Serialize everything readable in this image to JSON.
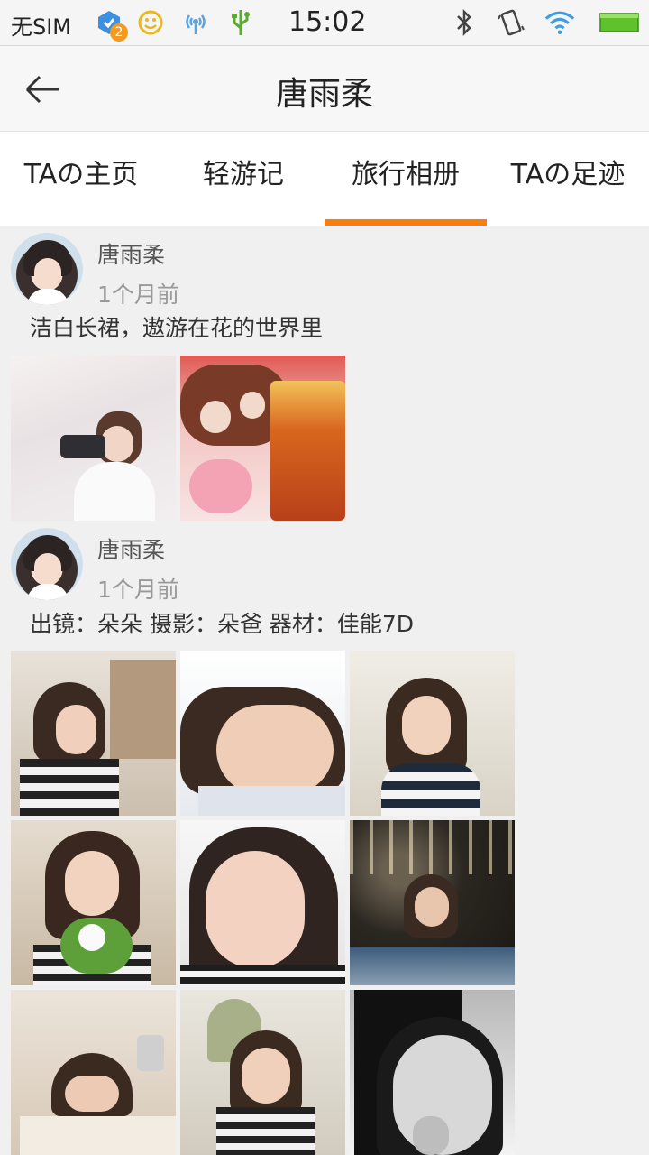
{
  "status_bar": {
    "carrier": "无SIM",
    "notification_count": "2",
    "time": "15:02"
  },
  "header": {
    "title": "唐雨柔",
    "back_icon": "arrow-left-icon"
  },
  "tabs": [
    {
      "label": "TAの主页",
      "active": false
    },
    {
      "label": "轻游记",
      "active": false
    },
    {
      "label": "旅行相册",
      "active": true
    },
    {
      "label": "TAの足迹",
      "active": false
    }
  ],
  "colors": {
    "accent": "#fb7d0c",
    "background": "#f0f0f0"
  },
  "posts": [
    {
      "author": "唐雨柔",
      "time": "1个月前",
      "description": "洁白长裙，遨游在花的世界里",
      "photos": [
        "girl-with-camera-in-blossoms",
        "iced-drink-with-flowers"
      ]
    },
    {
      "author": "唐雨柔",
      "time": "1个月前",
      "description": "出镜：朵朵 摄影：朵爸 器材：佳能7D",
      "photos": [
        "child-at-table",
        "child-lying-down",
        "child-smiling-striped-shirt",
        "child-with-flowers",
        "child-closeup-face",
        "child-with-lights",
        "child-drawing",
        "child-chin-on-hands",
        "child-black-and-white"
      ]
    }
  ]
}
